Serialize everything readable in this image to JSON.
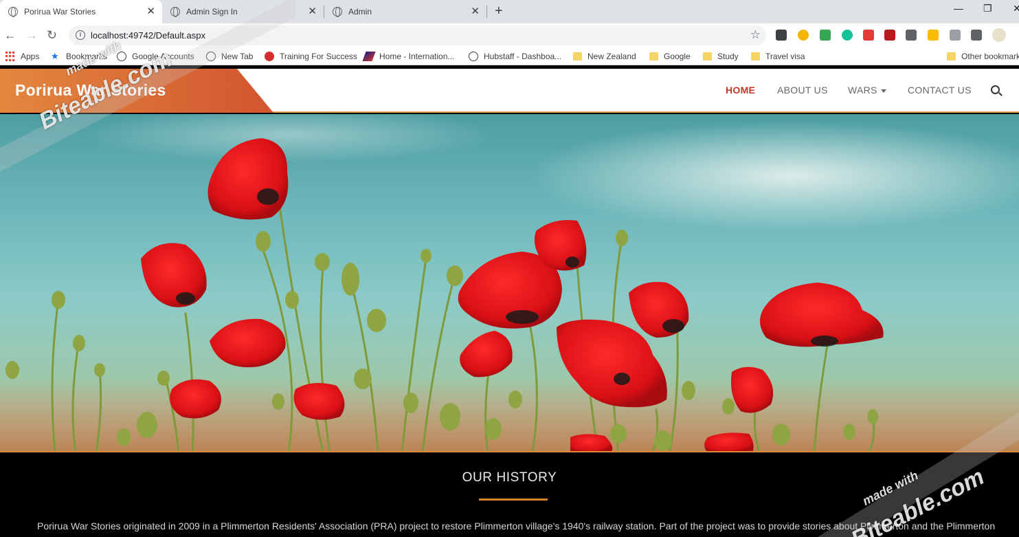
{
  "browser": {
    "tabs": [
      {
        "title": "Porirua War Stories",
        "active": true
      },
      {
        "title": "Admin Sign In",
        "active": false
      },
      {
        "title": "Admin",
        "active": false
      }
    ],
    "url": "localhost:49742/Default.aspx",
    "bookmarks": [
      {
        "label": "Apps",
        "icon": "apps-grid-icon"
      },
      {
        "label": "Bookmarks",
        "icon": "star-icon"
      },
      {
        "label": "Google Accounts",
        "icon": "globe-icon"
      },
      {
        "label": "New Tab",
        "icon": "globe-icon"
      },
      {
        "label": "Training For Success",
        "icon": "brand-icon"
      },
      {
        "label": "Home - Internation...",
        "icon": "brand-icon"
      },
      {
        "label": "Hubstaff - Dashboa...",
        "icon": "globe-icon"
      },
      {
        "label": "New Zealand",
        "icon": "folder-icon"
      },
      {
        "label": "Google",
        "icon": "folder-icon"
      },
      {
        "label": "Study",
        "icon": "folder-icon"
      },
      {
        "label": "Travel visa",
        "icon": "folder-icon"
      },
      {
        "label": "Other bookmarks",
        "icon": "folder-icon"
      }
    ]
  },
  "site": {
    "brand": "Porirua War Stories",
    "nav": {
      "home": "HOME",
      "about": "ABOUT US",
      "wars": "WARS",
      "contact": "CONTACT US"
    },
    "hero": {
      "alt": "poppies-image"
    },
    "history": {
      "heading": "OUR HISTORY",
      "text": "Porirua War Stories originated in 2009 in a Plimmerton Residents' Association (PRA) project to restore Plimmerton village's 1940's railway station. Part of the project was to provide stories about Plimmerton and the Plimmerton"
    }
  },
  "watermark": {
    "top": [
      "made with",
      "Biteable.com"
    ],
    "bottom": [
      "made with",
      "Biteable.com"
    ]
  },
  "colors": {
    "brand_gradient_start": "#e3873f",
    "brand_gradient_end": "#d2552f",
    "nav_active": "#c0392b",
    "accent_rule": "#d9822b",
    "poppy_red": "#e0161a"
  }
}
